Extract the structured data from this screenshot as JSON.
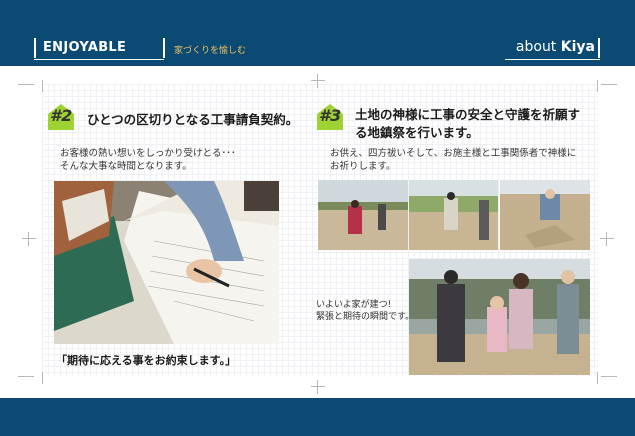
{
  "header": {
    "brand": "ENJOYABLE",
    "subtitle": "家づくりを愉しむ",
    "about_prefix": "about",
    "about_name": "Kiya"
  },
  "sections": [
    {
      "number": "2",
      "heading": "ひとつの区切りとなる工事請負契約。",
      "description_lines": [
        "お客様の熱い想いをしっかり受けとる･･･",
        "そんな大事な時間となります。"
      ],
      "caption": "「期待に応える事をお約束します。」"
    },
    {
      "number": "3",
      "heading_lines": [
        "土地の神様に工事の安全と守護を祈願す",
        "る地鎮祭を行います。"
      ],
      "description_lines": [
        "お供え、四方祓いそして、お施主様と工事関係者で神様に",
        "お祈りします。"
      ],
      "photo_caption_lines": [
        "いよいよ家が建つ!",
        "緊張と期待の瞬間です。"
      ]
    }
  ],
  "colors": {
    "navy": "#0b4a72",
    "badge_green": "#9fd233",
    "subtitle_gold": "#f0c060"
  }
}
